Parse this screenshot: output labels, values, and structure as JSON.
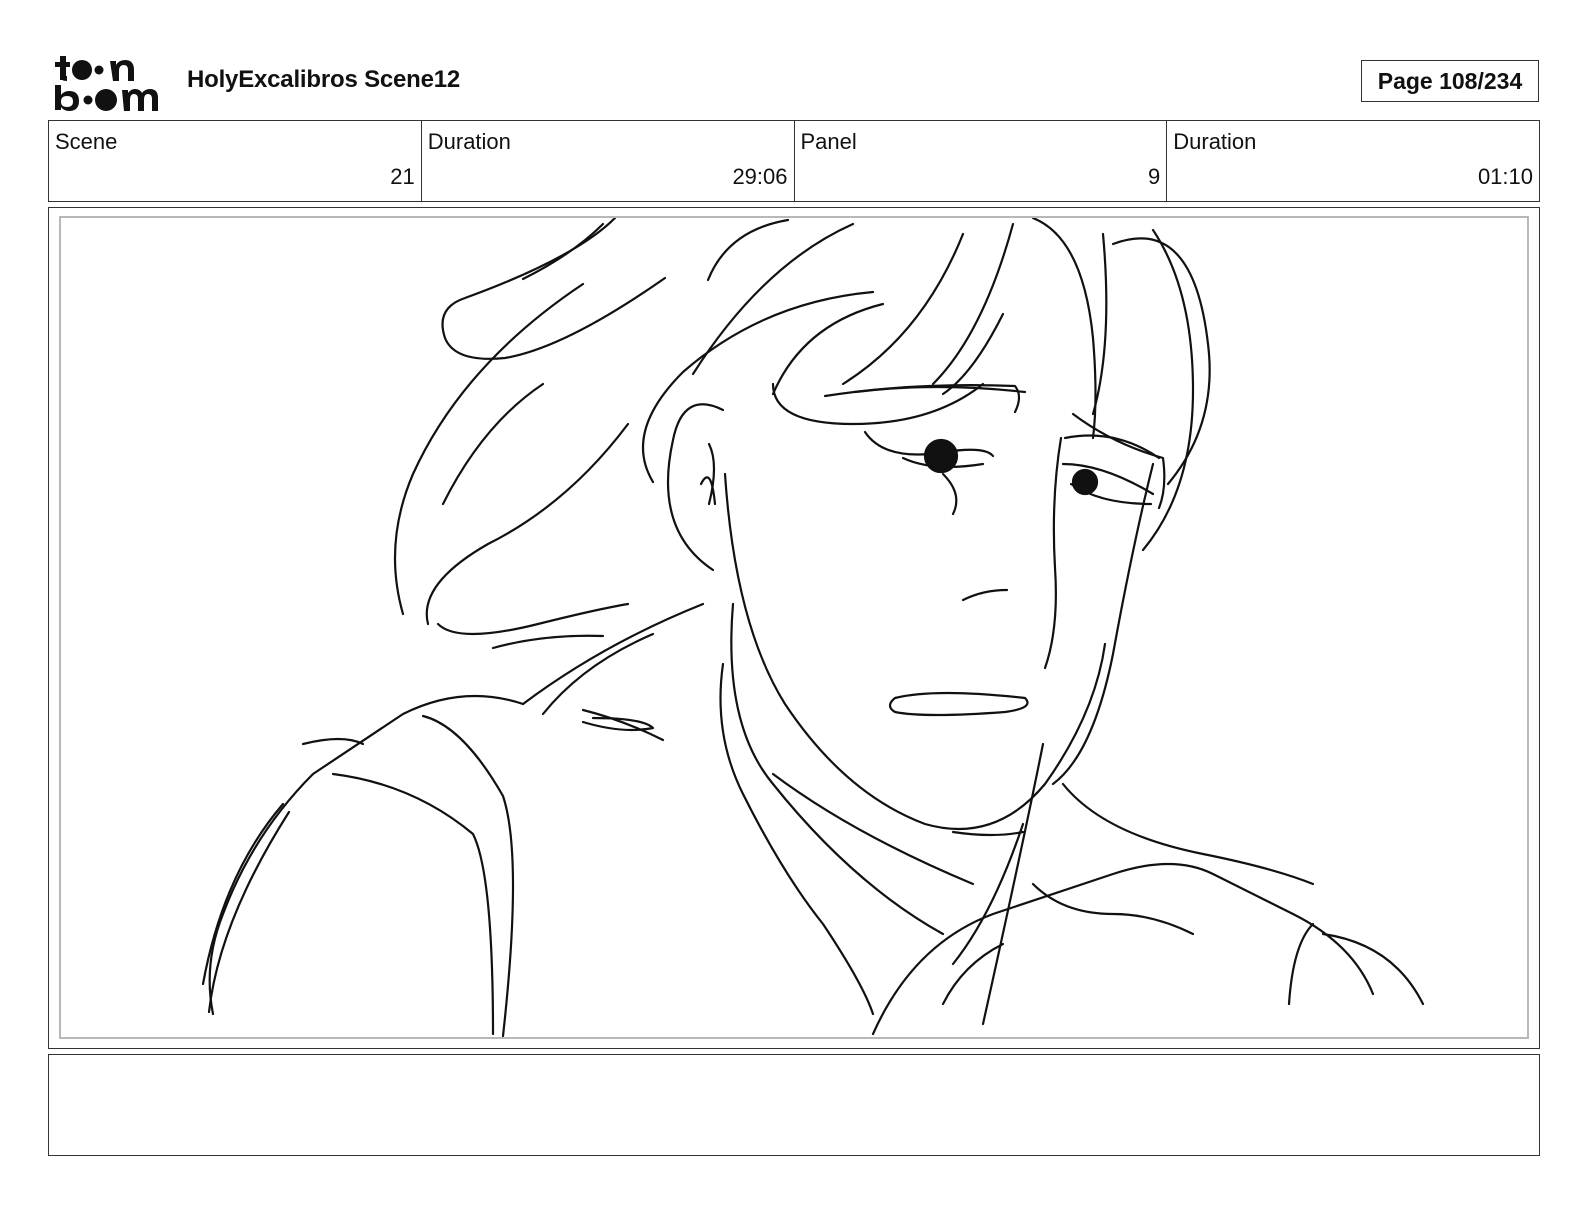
{
  "header": {
    "project_title": "HolyExcalibros Scene12",
    "page_label": "Page 108/234",
    "logo_icon": "toonboom-logo"
  },
  "info": {
    "scene_label": "Scene",
    "scene_value": "21",
    "scene_duration_label": "Duration",
    "scene_duration_value": "29:06",
    "panel_label": "Panel",
    "panel_value": "9",
    "panel_duration_label": "Duration",
    "panel_duration_value": "01:10"
  },
  "panel": {
    "image_icon": "storyboard-sketch"
  },
  "notes": {
    "text": ""
  }
}
